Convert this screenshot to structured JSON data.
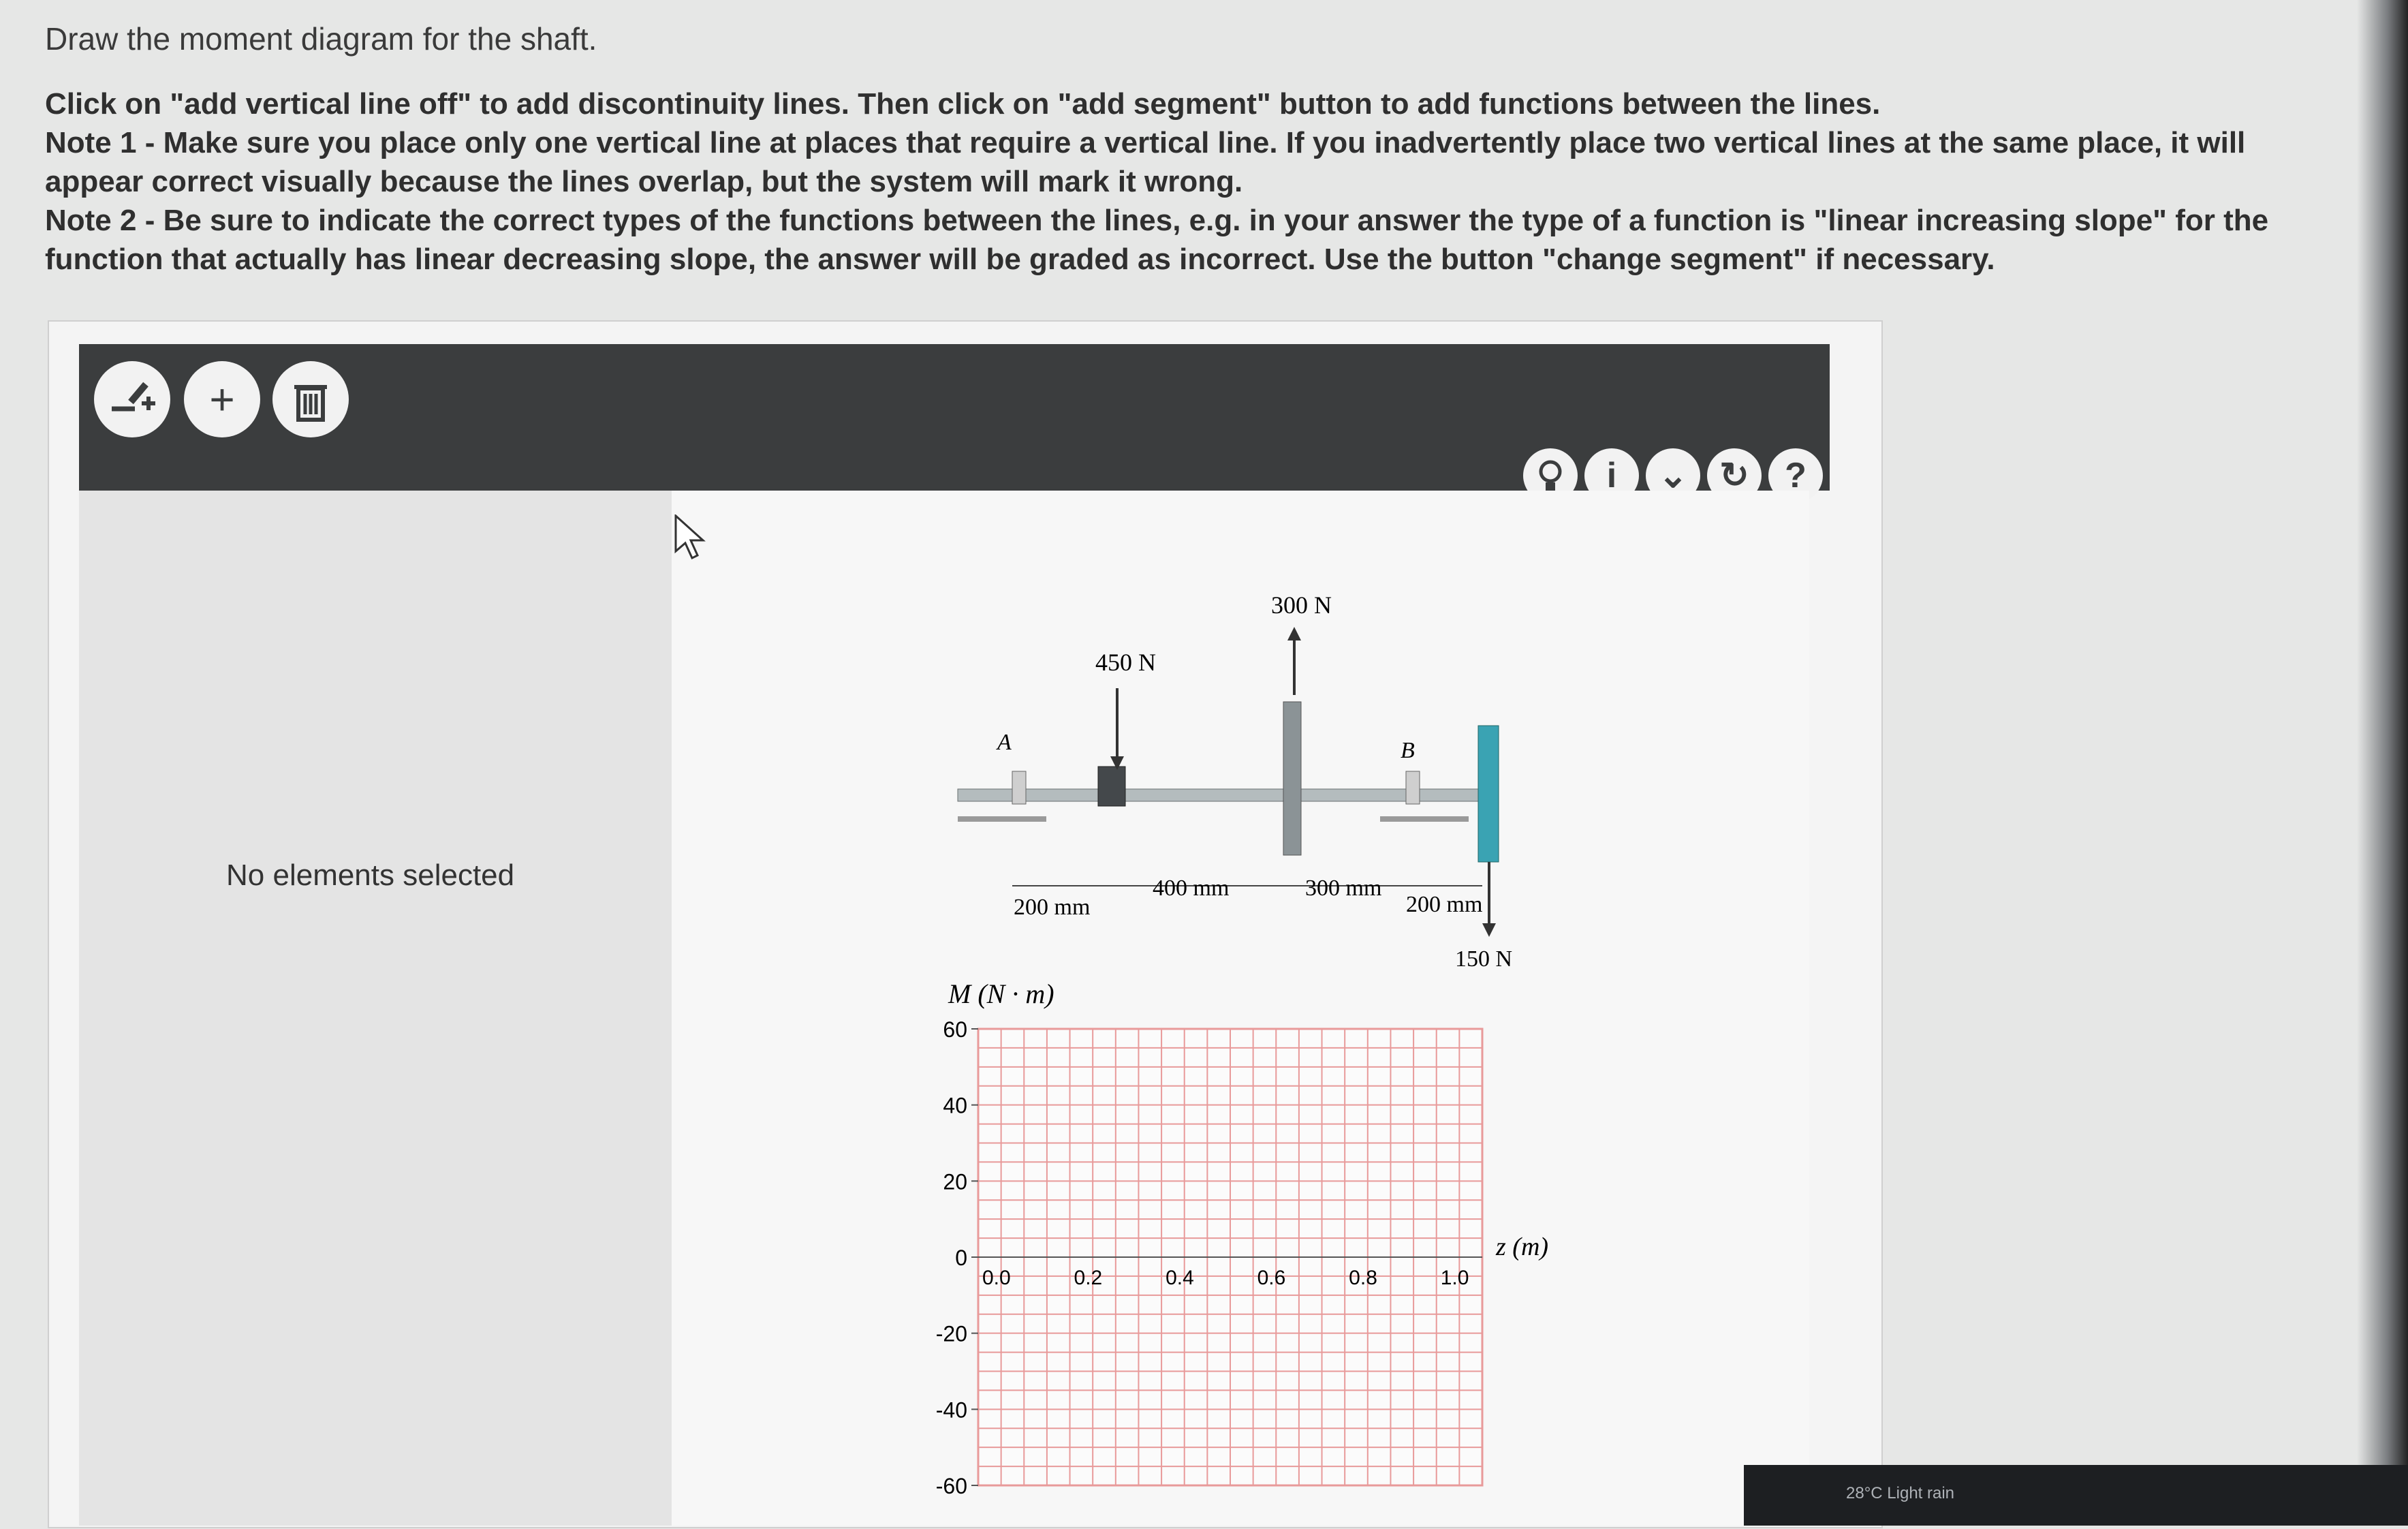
{
  "prompt": {
    "title": "Draw the moment diagram for the shaft.",
    "instruction": "Click on \"add vertical line off\" to add discontinuity lines. Then click on \"add segment\" button to add functions between the lines.",
    "note1": "Note 1 - Make sure you place only one vertical line at places that require a vertical line. If you inadvertently place two vertical lines at the same place, it will appear correct visually because the lines overlap, but the system will mark it wrong.",
    "note2": "Note 2 - Be sure to indicate the correct types of the functions between the lines, e.g. in your answer the type of a function is \"linear increasing slope\" for the function that actually has linear decreasing slope, the answer will be graded as incorrect. Use the button \"change segment\" if necessary."
  },
  "toolbar": {
    "icons": [
      "add-vertical-line-icon",
      "add-segment-icon",
      "delete-icon"
    ],
    "right_icons": [
      "hint-icon",
      "info-icon",
      "chevron-down-icon",
      "reset-icon",
      "help-icon"
    ],
    "add_segment_glyph": "+",
    "info_glyph": "i",
    "chevron_glyph": "⌄",
    "reset_glyph": "↻",
    "help_glyph": "?"
  },
  "side_panel": {
    "message": "No elements selected"
  },
  "figure": {
    "loads": {
      "f450": "450 N",
      "f300": "300 N",
      "f150": "150 N"
    },
    "supports": {
      "a": "A",
      "b": "B"
    },
    "dims": {
      "d1": "200 mm",
      "d2": "400 mm",
      "d3": "300 mm",
      "d4": "200 mm"
    }
  },
  "graph": {
    "ylabel": "M (N · m)",
    "xlabel": "z (m)",
    "yticks": [
      "60",
      "40",
      "20",
      "0",
      "-20",
      "-40",
      "-60"
    ],
    "xticks": [
      "0.0",
      "0.2",
      "0.4",
      "0.6",
      "0.8",
      "1.0"
    ],
    "ylim": [
      -60,
      60
    ],
    "xlim": [
      0,
      1.1
    ],
    "grid": true,
    "grid_color": "#e89a9a"
  },
  "taskbar": {
    "weather": "28°C  Light rain"
  }
}
